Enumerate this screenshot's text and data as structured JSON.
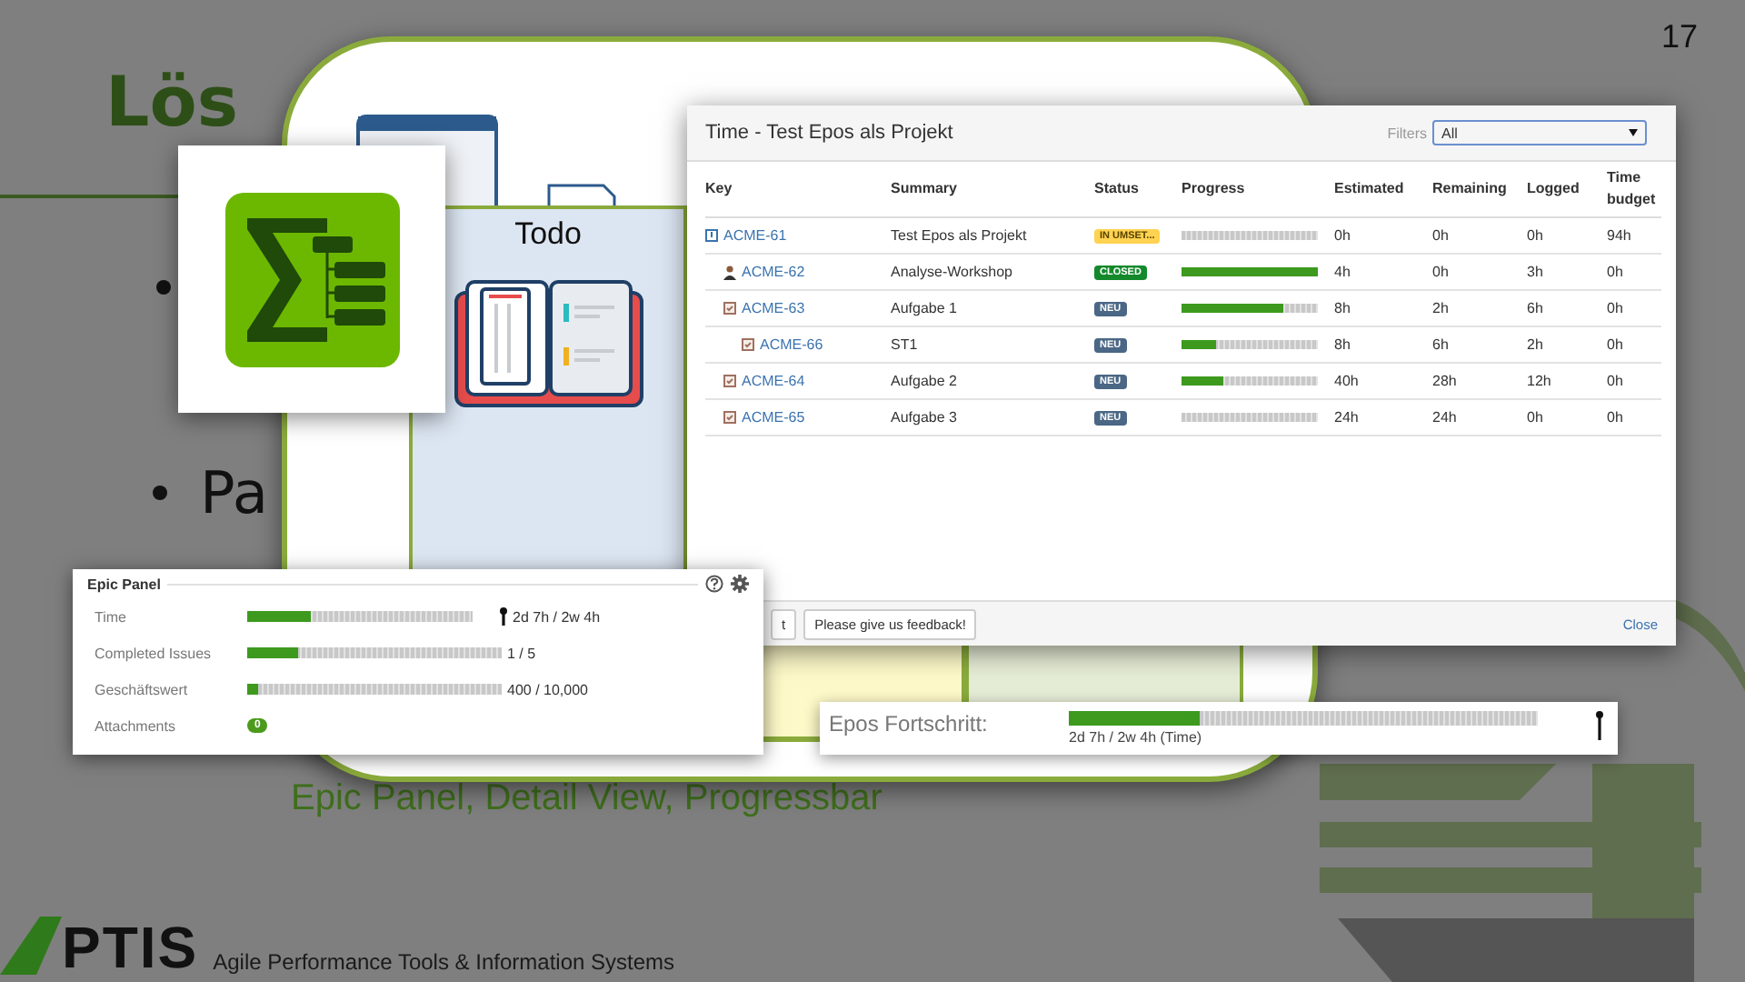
{
  "slide": {
    "title": "Lös",
    "bullets": [
      {
        "text": "Pa"
      }
    ],
    "sub_bullet": "Epic Panel, Detail View, Progressbar",
    "page_number": "17",
    "footer": {
      "logo": "PTIS",
      "tagline": "Agile Performance Tools & Information Systems"
    }
  },
  "board": {
    "columns": [
      {
        "title": "Todo",
        "color": "#dce6f2"
      },
      {
        "color": "#fdf9c8"
      },
      {
        "color": "#e6edd6"
      }
    ]
  },
  "time_dialog": {
    "title": "Time - Test Epos als Projekt",
    "filter": {
      "label": "Filters",
      "value": "All"
    },
    "columns": [
      "Key",
      "Summary",
      "Status",
      "Progress",
      "Estimated",
      "Remaining",
      "Logged",
      "Time budget"
    ],
    "rows": [
      {
        "key": "ACME-61",
        "kind": "epic",
        "summary": "Test Epos als Projekt",
        "status": "IN UMSET...",
        "color": "#ffd351",
        "level": 0,
        "estimated": "0h",
        "remaining": "0h",
        "logged": "0h",
        "budget": "94h",
        "children": [
          {
            "key": "ACME-62",
            "kind": "person",
            "summary": "Analyse-Workshop",
            "status": "CLOSED",
            "color": "#14892c",
            "level": 1,
            "estimated": "4h",
            "remaining": "0h",
            "logged": "3h",
            "budget": "0h"
          },
          {
            "key": "ACME-63",
            "kind": "task",
            "summary": "Aufgabe 1",
            "status": "NEU",
            "color": "#4a6785",
            "level": 0.75,
            "estimated": "8h",
            "remaining": "2h",
            "logged": "6h",
            "budget": "0h",
            "children": [
              {
                "key": "ACME-66",
                "kind": "subtask",
                "summary": "ST1",
                "status": "NEU",
                "color": "#4a6785",
                "level": 0.25,
                "estimated": "8h",
                "remaining": "6h",
                "logged": "2h",
                "budget": "0h"
              }
            ]
          },
          {
            "key": "ACME-64",
            "kind": "task",
            "summary": "Aufgabe 2",
            "status": "NEU",
            "color": "#4a6785",
            "level": 0.3,
            "estimated": "40h",
            "remaining": "28h",
            "logged": "12h",
            "budget": "0h"
          },
          {
            "key": "ACME-65",
            "kind": "task",
            "summary": "Aufgabe 3",
            "status": "NEU",
            "color": "#4a6785",
            "level": 0,
            "estimated": "24h",
            "remaining": "24h",
            "logged": "0h",
            "budget": "0h"
          }
        ]
      }
    ],
    "buttons": [
      "t",
      "Please give us feedback!"
    ],
    "close": "Close"
  },
  "epic_panel": {
    "title": "Epic Panel",
    "rows": [
      {
        "label": "Time",
        "kind": "bar",
        "level": 0.28,
        "reading": "2d 7h / 2w 4h",
        "marker": true
      },
      {
        "label": "Completed Issues",
        "kind": "bar",
        "level": 0.2,
        "reading": "1 / 5",
        "marker": false
      },
      {
        "label": "Geschäftswert",
        "kind": "bar",
        "level": 0.04,
        "reading": "400 / 10,000",
        "marker": false
      },
      {
        "label": "Attachments",
        "kind": "badge",
        "count": "0"
      }
    ]
  },
  "epos_bar": {
    "label": "Epos Fortschritt:",
    "level": 0.28,
    "caption": "2d 7h / 2w 4h (Time)"
  }
}
